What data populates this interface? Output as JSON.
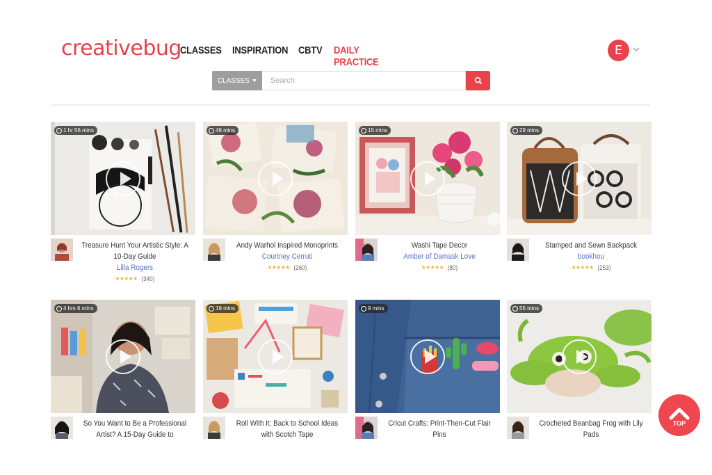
{
  "header": {
    "logo": "creativebug",
    "nav": [
      {
        "label": "CLASSES"
      },
      {
        "label": "INSPIRATION"
      },
      {
        "label": "CBTV"
      },
      {
        "label": "DAILY PRACTICE"
      }
    ],
    "user_initial": "E",
    "accent_color": "#e8424a"
  },
  "search": {
    "category": "CLASSES",
    "placeholder": "Search",
    "button_icon": "search-icon"
  },
  "cards": [
    {
      "duration": "1 hr 56 mins",
      "title": "Treasure Hunt Your Artistic Style: A 10-Day Guide",
      "author": "Lilla Rogers",
      "stars": "★★★★★",
      "reviews": "(340)"
    },
    {
      "duration": "48 mins",
      "title": "Andy Warhol Inspired Monoprints",
      "author": "Courtney Cerruti",
      "stars": "★★★★★",
      "reviews": "(260)"
    },
    {
      "duration": "15 mins",
      "title": "Washi Tape Decor",
      "author": "Amber of Damask Love",
      "stars": "★★★★★",
      "reviews": "(80)"
    },
    {
      "duration": "29 mins",
      "title": "Stamped and Sewn Backpack",
      "author": "bookhou",
      "stars": "★★★★★",
      "reviews": "(253)"
    },
    {
      "duration": "4 hrs 6 mins",
      "title": "So You Want to Be a Professional Artist? A 15-Day Guide to"
    },
    {
      "duration": "19 mins",
      "title": "Roll With It: Back to School Ideas with Scotch Tape"
    },
    {
      "duration": "9 mins",
      "title": "Cricut Crafts: Print-Then-Cut Flair Pins"
    },
    {
      "duration": "55 mins",
      "title": "Crocheted Beanbag Frog with Lily Pads"
    }
  ],
  "back_to_top": "TOP"
}
